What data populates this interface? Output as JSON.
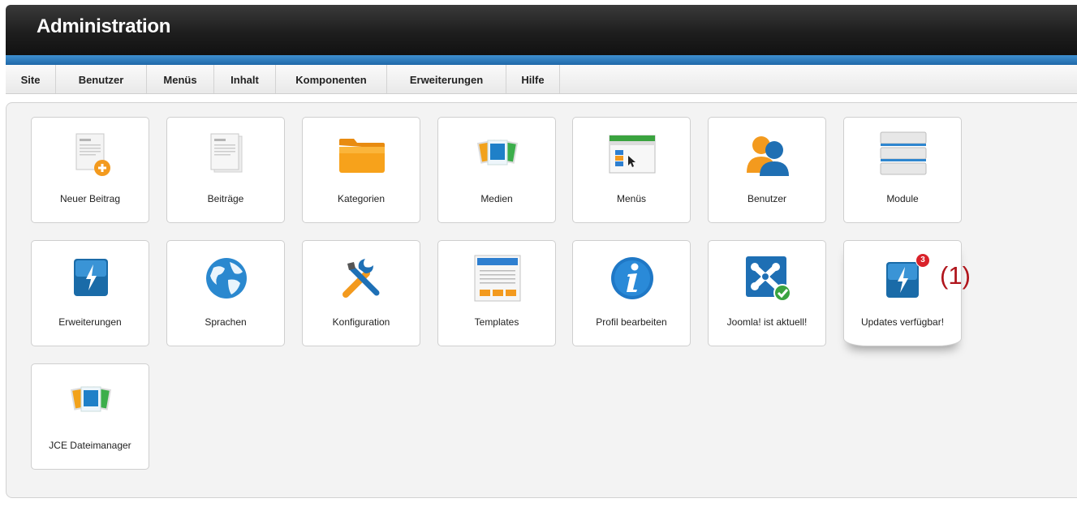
{
  "header": {
    "title": "Administration"
  },
  "menu": [
    {
      "label": "Site"
    },
    {
      "label": "Benutzer"
    },
    {
      "label": "Menüs"
    },
    {
      "label": "Inhalt"
    },
    {
      "label": "Komponenten"
    },
    {
      "label": "Erweiterungen"
    },
    {
      "label": "Hilfe"
    }
  ],
  "tiles": [
    {
      "label": "Neuer Beitrag",
      "icon": "new-article-icon"
    },
    {
      "label": "Beiträge",
      "icon": "articles-icon"
    },
    {
      "label": "Kategorien",
      "icon": "folder-icon"
    },
    {
      "label": "Medien",
      "icon": "media-icon"
    },
    {
      "label": "Menüs",
      "icon": "menu-manager-icon"
    },
    {
      "label": "Benutzer",
      "icon": "users-icon"
    },
    {
      "label": "Module",
      "icon": "modules-icon"
    },
    {
      "label": "Erweiterungen",
      "icon": "extensions-icon"
    },
    {
      "label": "Sprachen",
      "icon": "globe-icon"
    },
    {
      "label": "Konfiguration",
      "icon": "tools-icon"
    },
    {
      "label": "Templates",
      "icon": "templates-icon"
    },
    {
      "label": "Profil bearbeiten",
      "icon": "info-icon"
    },
    {
      "label": "Joomla! ist aktuell!",
      "icon": "joomla-logo-icon"
    },
    {
      "label": "Updates verfügbar!",
      "icon": "updates-icon",
      "badge": "3"
    },
    {
      "label": "JCE Dateimanager",
      "icon": "jce-media-icon"
    }
  ],
  "annotation": "(1)",
  "colors": {
    "accent_blue": "#1f68a8",
    "badge_red": "#d9222a",
    "folder_orange": "#f7a21b"
  }
}
